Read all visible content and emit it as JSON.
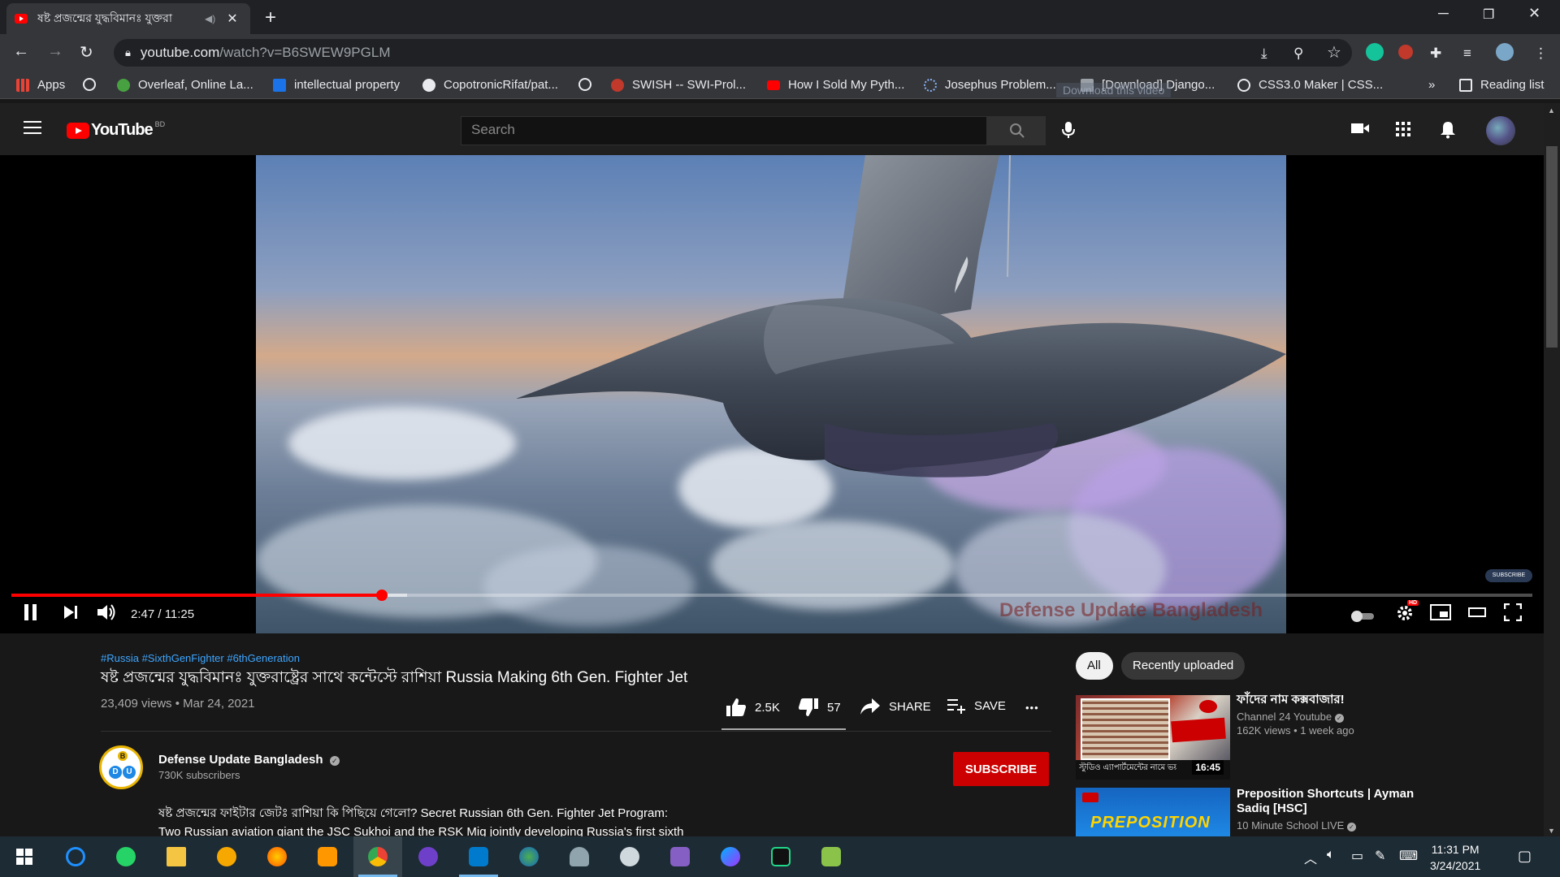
{
  "browser": {
    "tab_title": "ষষ্ট প্রজন্মের যুদ্ধবিমানঃ যুক্তরা",
    "url_host": "youtube.com",
    "url_path": "/watch?v=B6SWEW9PGLM",
    "bookmarks": [
      {
        "label": "Apps",
        "icon": "apps-grid-icon",
        "color": "#4285f4"
      },
      {
        "label": "",
        "icon": "globe-icon",
        "color": "#e8eaed"
      },
      {
        "label": "Overleaf, Online La...",
        "icon": "overleaf-icon",
        "color": "#47a141"
      },
      {
        "label": "intellectual property",
        "icon": "scholar-icon",
        "color": "#1a73e8"
      },
      {
        "label": "CopotronicRifat/pat...",
        "icon": "github-icon",
        "color": "#e8eaed"
      },
      {
        "label": "",
        "icon": "globe-icon",
        "color": "#e8eaed"
      },
      {
        "label": "SWISH -- SWI-Prol...",
        "icon": "swi-prolog-icon",
        "color": "#c0392b"
      },
      {
        "label": "How I Sold My Pyth...",
        "icon": "youtube-icon",
        "color": "#ff0000"
      },
      {
        "label": "Josephus Problem...",
        "icon": "loading-icon",
        "color": "#8ab4f8"
      },
      {
        "label": "[Download] Django...",
        "icon": "page-icon",
        "color": "#9aa0a6"
      },
      {
        "label": "CSS3.0 Maker | CSS...",
        "icon": "globe-icon",
        "color": "#e8eaed"
      }
    ],
    "overflow_label": "»",
    "reading_list_label": "Reading list",
    "download_overlay": "Download this video"
  },
  "youtube": {
    "logo_text": "YouTube",
    "country_code": "BD",
    "search_placeholder": "Search"
  },
  "player": {
    "time": "2:47 / 11:25",
    "progress": 0.2434,
    "buffered": 0.26,
    "watermark": "Defense Update Bangladesh",
    "subscribe_badge": "SUBSCRIBE",
    "hd_badge": "HD"
  },
  "video": {
    "hashtags": "#Russia #SixthGenFighter #6thGeneration",
    "title": "ষষ্ট প্রজন্মের যুদ্ধবিমানঃ যুক্তরাষ্ট্রের সাথে কন্টেস্টে রাশিয়া Russia Making 6th Gen. Fighter Jet",
    "views_date": "23,409 views • Mar 24, 2021",
    "likes": "2.5K",
    "dislikes": "57",
    "share_label": "SHARE",
    "save_label": "SAVE",
    "more_label": "•••"
  },
  "channel": {
    "name": "Defense Update Bangladesh",
    "subscribers": "730K subscribers",
    "subscribe_label": "SUBSCRIBE",
    "avatar_letters": [
      "B",
      "D",
      "U"
    ],
    "description_line1": "ষষ্ট প্রজন্মের ফাইটার জেটঃ রাশিয়া কি পিছিয়ে গেলো? Secret Russian 6th Gen. Fighter Jet Program:",
    "description_line2": "Two Russian aviation giant the JSC Sukhoi and the RSK Mig jointly developing Russia's first sixth"
  },
  "sidebar": {
    "chips": [
      "All",
      "Recently uploaded"
    ],
    "recommendations": [
      {
        "title": "ফাঁদের নাম কক্সবাজার!",
        "channel": "Channel 24 Youtube",
        "meta": "162K views • 1 week ago",
        "duration": "16:45",
        "thumb_caption": "স্টুডিও এ্যাপার্টমেন্টের নামে ভয়াব"
      },
      {
        "title": "Preposition Shortcuts | Ayman Sadiq [HSC]",
        "channel": "10 Minute School LIVE",
        "meta": "",
        "duration": "",
        "thumb_caption": "PREPOSITION"
      }
    ]
  },
  "taskbar": {
    "clock_time": "11:31 PM",
    "clock_date": "3/24/2021"
  },
  "colors": {
    "youtube_red": "#ff0000",
    "link_blue": "#3ea6ff",
    "subscribe_red": "#cc0000",
    "taskbar_bg": "#1d2b34"
  }
}
